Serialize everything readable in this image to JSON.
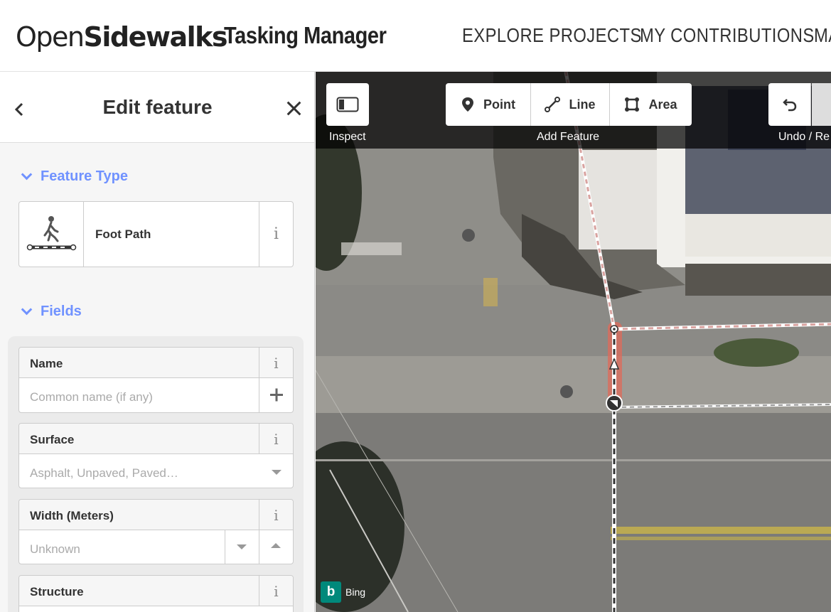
{
  "header": {
    "logo_text_open": "Open",
    "logo_text_sidewalks": "Sidewalks",
    "app_title": "Tasking Manager",
    "nav": [
      "EXPLORE PROJECTS",
      "MY CONTRIBUTIONS",
      "MA"
    ]
  },
  "panel": {
    "back_icon": "chevron-left-icon",
    "title": "Edit feature",
    "close_icon": "close-icon",
    "feature_type_heading": "Feature Type",
    "feature_type": {
      "label": "Foot Path",
      "icon": "pedestrian-footpath-icon",
      "info": "i"
    },
    "fields_heading": "Fields",
    "fields": [
      {
        "label": "Name",
        "info": "i",
        "placeholder": "Common name (if any)",
        "control": "add"
      },
      {
        "label": "Surface",
        "info": "i",
        "placeholder": "Asphalt, Unpaved, Paved…",
        "control": "combo"
      },
      {
        "label": "Width (Meters)",
        "info": "i",
        "placeholder": "Unknown",
        "control": "stepper"
      },
      {
        "label": "Structure",
        "info": "i"
      }
    ]
  },
  "map": {
    "toolbar": {
      "inspect_caption": "Inspect",
      "point_label": "Point",
      "line_label": "Line",
      "area_label": "Area",
      "add_feature_caption": "Add Feature",
      "undo_caption": "Undo / Re"
    },
    "attribution": "Bing",
    "colors": {
      "selected_highlight": "#e06a5a",
      "path_dash": "#d9a3a0",
      "accent": "#7092ff"
    }
  }
}
